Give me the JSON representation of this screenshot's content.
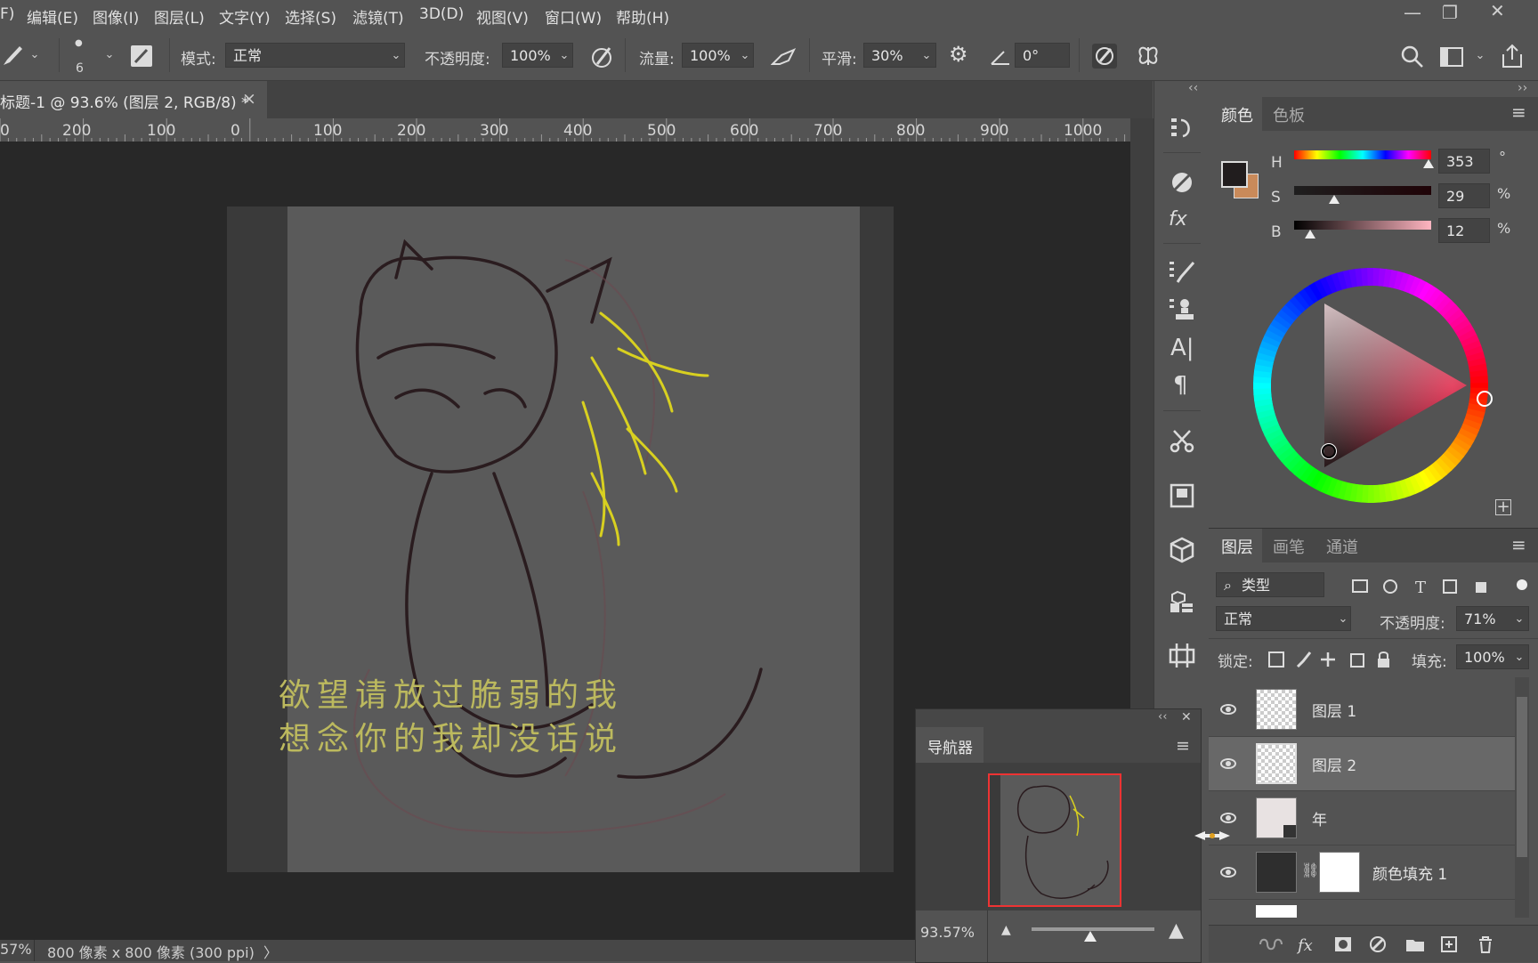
{
  "menubar": {
    "items": [
      "F)",
      "编辑(E)",
      "图像(I)",
      "图层(L)",
      "文字(Y)",
      "选择(S)",
      "滤镜(T)",
      "3D(D)",
      "视图(V)",
      "窗口(W)",
      "帮助(H)"
    ]
  },
  "options": {
    "brush_size": "6",
    "mode_label": "模式:",
    "mode_value": "正常",
    "opacity_label": "不透明度:",
    "opacity_value": "100%",
    "flow_label": "流量:",
    "flow_value": "100%",
    "smooth_label": "平滑:",
    "smooth_value": "30%",
    "angle_value": "0°"
  },
  "document": {
    "tab_title": "标题-1 @ 93.6% (图层 2, RGB/8) *",
    "close_glyph": "×",
    "lyrics": [
      "欲望请放过脆弱的我",
      "想念你的我却没话说"
    ]
  },
  "ruler": {
    "labels": [
      "0",
      "200",
      "100",
      "0",
      "100",
      "200",
      "300",
      "400",
      "500",
      "600",
      "700",
      "800",
      "900",
      "1000"
    ]
  },
  "status": {
    "zoom": "57%",
    "doc_info": "800 像素 x 800 像素 (300 ppi)",
    "arrow": "〉"
  },
  "color_panel": {
    "tabs": [
      "颜色",
      "色板"
    ],
    "h_label": "H",
    "h_value": "353",
    "h_unit": "°",
    "s_label": "S",
    "s_value": "29",
    "s_unit": "%",
    "b_label": "B",
    "b_value": "12",
    "b_unit": "%",
    "foreground": "#211d1e",
    "background": "#c98a5a",
    "hue": 353,
    "saturation": 29,
    "brightness": 12
  },
  "layers_panel": {
    "tabs": [
      "图层",
      "画笔",
      "通道"
    ],
    "filter_label": "类型",
    "blend_mode": "正常",
    "opacity_label": "不透明度:",
    "opacity_value": "71%",
    "lock_label": "锁定:",
    "fill_label": "填充:",
    "fill_value": "100%",
    "layers": [
      {
        "name": "图层 1"
      },
      {
        "name": "图层 2"
      },
      {
        "name": "年"
      },
      {
        "name": "颜色填充 1"
      }
    ]
  },
  "navigator": {
    "title": "导航器",
    "zoom": "93.57%",
    "zoom_slider": 0.48
  },
  "icons": {
    "collapse_left": "‹‹",
    "collapse_right": "››",
    "close": "✕",
    "menu": "≡",
    "add": "+",
    "fx": "fx"
  }
}
